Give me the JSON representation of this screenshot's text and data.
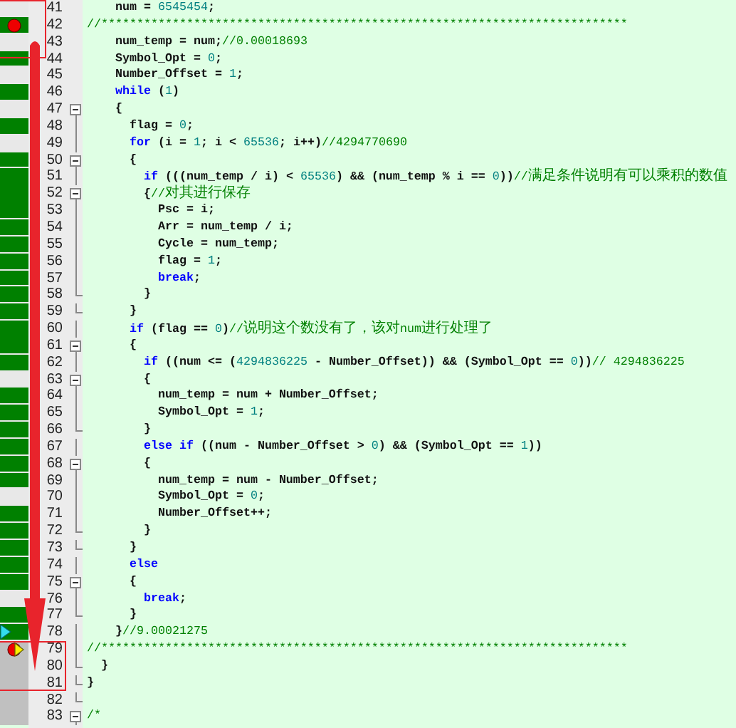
{
  "editor": {
    "lines": [
      {
        "number": "41",
        "breakpoint": false,
        "executed": false,
        "unreached": false,
        "foldable": false,
        "fold_end": false,
        "tokens": [
          {
            "kind": "plain",
            "text": "    num = "
          },
          {
            "kind": "number",
            "text": "6545454"
          },
          {
            "kind": "plain",
            "text": ";"
          }
        ]
      },
      {
        "number": "42",
        "breakpoint": true,
        "executed": true,
        "unreached": false,
        "foldable": false,
        "fold_end": false,
        "tokens": [
          {
            "kind": "comment",
            "text": "//**************************************************************************"
          }
        ]
      },
      {
        "number": "43",
        "breakpoint": false,
        "executed": false,
        "unreached": false,
        "foldable": false,
        "fold_end": false,
        "tokens": [
          {
            "kind": "plain",
            "text": "    num_temp = num;"
          },
          {
            "kind": "comment",
            "text": "//0.00018693"
          }
        ]
      },
      {
        "number": "44",
        "breakpoint": false,
        "executed": true,
        "unreached": false,
        "foldable": false,
        "fold_end": false,
        "tokens": [
          {
            "kind": "plain",
            "text": "    Symbol_Opt = "
          },
          {
            "kind": "number",
            "text": "0"
          },
          {
            "kind": "plain",
            "text": ";"
          }
        ]
      },
      {
        "number": "45",
        "breakpoint": false,
        "executed": false,
        "unreached": false,
        "foldable": false,
        "fold_end": false,
        "tokens": [
          {
            "kind": "plain",
            "text": "    Number_Offset = "
          },
          {
            "kind": "number",
            "text": "1"
          },
          {
            "kind": "plain",
            "text": ";"
          }
        ]
      },
      {
        "number": "46",
        "breakpoint": false,
        "executed": true,
        "unreached": false,
        "foldable": false,
        "fold_end": false,
        "tokens": [
          {
            "kind": "keyword",
            "text": "    while"
          },
          {
            "kind": "plain",
            "text": " ("
          },
          {
            "kind": "number",
            "text": "1"
          },
          {
            "kind": "plain",
            "text": ")"
          }
        ]
      },
      {
        "number": "47",
        "breakpoint": false,
        "executed": false,
        "unreached": false,
        "foldable": true,
        "fold_end": false,
        "tokens": [
          {
            "kind": "plain",
            "text": "    {"
          }
        ]
      },
      {
        "number": "48",
        "breakpoint": false,
        "executed": true,
        "unreached": false,
        "foldable": false,
        "fold_end": false,
        "tokens": [
          {
            "kind": "plain",
            "text": "      flag = "
          },
          {
            "kind": "number",
            "text": "0"
          },
          {
            "kind": "plain",
            "text": ";"
          }
        ]
      },
      {
        "number": "49",
        "breakpoint": false,
        "executed": false,
        "unreached": false,
        "foldable": false,
        "fold_end": false,
        "tokens": [
          {
            "kind": "keyword",
            "text": "      for"
          },
          {
            "kind": "plain",
            "text": " (i = "
          },
          {
            "kind": "number",
            "text": "1"
          },
          {
            "kind": "plain",
            "text": "; i < "
          },
          {
            "kind": "number",
            "text": "65536"
          },
          {
            "kind": "plain",
            "text": "; i++)"
          },
          {
            "kind": "comment",
            "text": "//4294770690"
          }
        ]
      },
      {
        "number": "50",
        "breakpoint": false,
        "executed": true,
        "unreached": false,
        "foldable": true,
        "fold_end": false,
        "tokens": [
          {
            "kind": "plain",
            "text": "      {"
          }
        ]
      },
      {
        "number": "51",
        "breakpoint": false,
        "executed": true,
        "unreached": false,
        "foldable": false,
        "fold_end": false,
        "tokens": [
          {
            "kind": "keyword",
            "text": "        if"
          },
          {
            "kind": "plain",
            "text": " (((num_temp / i) < "
          },
          {
            "kind": "number",
            "text": "65536"
          },
          {
            "kind": "plain",
            "text": ") && (num_temp % i == "
          },
          {
            "kind": "number",
            "text": "0"
          },
          {
            "kind": "plain",
            "text": "))"
          },
          {
            "kind": "comment",
            "text": "//满足条件说明有可以乘积的数值"
          }
        ]
      },
      {
        "number": "52",
        "breakpoint": false,
        "executed": true,
        "unreached": false,
        "foldable": true,
        "fold_end": false,
        "tokens": [
          {
            "kind": "plain",
            "text": "        {"
          },
          {
            "kind": "comment",
            "text": "//对其进行保存"
          }
        ]
      },
      {
        "number": "53",
        "breakpoint": false,
        "executed": true,
        "unreached": false,
        "foldable": false,
        "fold_end": false,
        "tokens": [
          {
            "kind": "plain",
            "text": "          Psc = i;"
          }
        ]
      },
      {
        "number": "54",
        "breakpoint": false,
        "executed": true,
        "unreached": false,
        "foldable": false,
        "fold_end": false,
        "tokens": [
          {
            "kind": "plain",
            "text": "          Arr = num_temp / i;"
          }
        ]
      },
      {
        "number": "55",
        "breakpoint": false,
        "executed": true,
        "unreached": false,
        "foldable": false,
        "fold_end": false,
        "tokens": [
          {
            "kind": "plain",
            "text": "          Cycle = num_temp;"
          }
        ]
      },
      {
        "number": "56",
        "breakpoint": false,
        "executed": true,
        "unreached": false,
        "foldable": false,
        "fold_end": false,
        "tokens": [
          {
            "kind": "plain",
            "text": "          flag = "
          },
          {
            "kind": "number",
            "text": "1"
          },
          {
            "kind": "plain",
            "text": ";"
          }
        ]
      },
      {
        "number": "57",
        "breakpoint": false,
        "executed": true,
        "unreached": false,
        "foldable": false,
        "fold_end": false,
        "tokens": [
          {
            "kind": "keyword",
            "text": "          break"
          },
          {
            "kind": "plain",
            "text": ";"
          }
        ]
      },
      {
        "number": "58",
        "breakpoint": false,
        "executed": true,
        "unreached": false,
        "foldable": false,
        "fold_end": true,
        "tokens": [
          {
            "kind": "plain",
            "text": "        }"
          }
        ]
      },
      {
        "number": "59",
        "breakpoint": false,
        "executed": true,
        "unreached": false,
        "foldable": false,
        "fold_end": true,
        "tokens": [
          {
            "kind": "plain",
            "text": "      }"
          }
        ]
      },
      {
        "number": "60",
        "breakpoint": false,
        "executed": true,
        "unreached": false,
        "foldable": false,
        "fold_end": false,
        "tokens": [
          {
            "kind": "keyword",
            "text": "      if"
          },
          {
            "kind": "plain",
            "text": " (flag == "
          },
          {
            "kind": "number",
            "text": "0"
          },
          {
            "kind": "plain",
            "text": ")"
          },
          {
            "kind": "comment",
            "text": "//说明这个数没有了，该对num进行处理了"
          }
        ]
      },
      {
        "number": "61",
        "breakpoint": false,
        "executed": true,
        "unreached": false,
        "foldable": true,
        "fold_end": false,
        "tokens": [
          {
            "kind": "plain",
            "text": "      {"
          }
        ]
      },
      {
        "number": "62",
        "breakpoint": false,
        "executed": true,
        "unreached": false,
        "foldable": false,
        "fold_end": false,
        "tokens": [
          {
            "kind": "keyword",
            "text": "        if"
          },
          {
            "kind": "plain",
            "text": " ((num <= ("
          },
          {
            "kind": "number",
            "text": "4294836225"
          },
          {
            "kind": "plain",
            "text": " - Number_Offset)) && (Symbol_Opt == "
          },
          {
            "kind": "number",
            "text": "0"
          },
          {
            "kind": "plain",
            "text": "))"
          },
          {
            "kind": "comment",
            "text": "// 4294836225"
          }
        ]
      },
      {
        "number": "63",
        "breakpoint": false,
        "executed": false,
        "unreached": false,
        "foldable": true,
        "fold_end": false,
        "tokens": [
          {
            "kind": "plain",
            "text": "        {"
          }
        ]
      },
      {
        "number": "64",
        "breakpoint": false,
        "executed": true,
        "unreached": false,
        "foldable": false,
        "fold_end": false,
        "tokens": [
          {
            "kind": "plain",
            "text": "          num_temp = num + Number_Offset;"
          }
        ]
      },
      {
        "number": "65",
        "breakpoint": false,
        "executed": true,
        "unreached": false,
        "foldable": false,
        "fold_end": false,
        "tokens": [
          {
            "kind": "plain",
            "text": "          Symbol_Opt = "
          },
          {
            "kind": "number",
            "text": "1"
          },
          {
            "kind": "plain",
            "text": ";"
          }
        ]
      },
      {
        "number": "66",
        "breakpoint": false,
        "executed": true,
        "unreached": false,
        "foldable": false,
        "fold_end": true,
        "tokens": [
          {
            "kind": "plain",
            "text": "        }"
          }
        ]
      },
      {
        "number": "67",
        "breakpoint": false,
        "executed": true,
        "unreached": false,
        "foldable": false,
        "fold_end": false,
        "tokens": [
          {
            "kind": "keyword",
            "text": "        else if"
          },
          {
            "kind": "plain",
            "text": " ((num - Number_Offset > "
          },
          {
            "kind": "number",
            "text": "0"
          },
          {
            "kind": "plain",
            "text": ") && (Symbol_Opt == "
          },
          {
            "kind": "number",
            "text": "1"
          },
          {
            "kind": "plain",
            "text": "))"
          }
        ]
      },
      {
        "number": "68",
        "breakpoint": false,
        "executed": true,
        "unreached": false,
        "foldable": true,
        "fold_end": false,
        "tokens": [
          {
            "kind": "plain",
            "text": "        {"
          }
        ]
      },
      {
        "number": "69",
        "breakpoint": false,
        "executed": true,
        "unreached": false,
        "foldable": false,
        "fold_end": false,
        "tokens": [
          {
            "kind": "plain",
            "text": "          num_temp = num - Number_Offset;"
          }
        ]
      },
      {
        "number": "70",
        "breakpoint": false,
        "executed": false,
        "unreached": false,
        "foldable": false,
        "fold_end": false,
        "tokens": [
          {
            "kind": "plain",
            "text": "          Symbol_Opt = "
          },
          {
            "kind": "number",
            "text": "0"
          },
          {
            "kind": "plain",
            "text": ";"
          }
        ]
      },
      {
        "number": "71",
        "breakpoint": false,
        "executed": true,
        "unreached": false,
        "foldable": false,
        "fold_end": false,
        "tokens": [
          {
            "kind": "plain",
            "text": "          Number_Offset++;"
          }
        ]
      },
      {
        "number": "72",
        "breakpoint": false,
        "executed": true,
        "unreached": false,
        "foldable": false,
        "fold_end": true,
        "tokens": [
          {
            "kind": "plain",
            "text": "        }"
          }
        ]
      },
      {
        "number": "73",
        "breakpoint": false,
        "executed": true,
        "unreached": false,
        "foldable": false,
        "fold_end": true,
        "tokens": [
          {
            "kind": "plain",
            "text": "      }"
          }
        ]
      },
      {
        "number": "74",
        "breakpoint": false,
        "executed": true,
        "unreached": false,
        "foldable": false,
        "fold_end": false,
        "tokens": [
          {
            "kind": "keyword",
            "text": "      else"
          }
        ]
      },
      {
        "number": "75",
        "breakpoint": false,
        "executed": true,
        "unreached": false,
        "foldable": true,
        "fold_end": false,
        "tokens": [
          {
            "kind": "plain",
            "text": "      {"
          }
        ]
      },
      {
        "number": "76",
        "breakpoint": false,
        "executed": false,
        "unreached": false,
        "foldable": false,
        "fold_end": false,
        "tokens": [
          {
            "kind": "keyword",
            "text": "        break"
          },
          {
            "kind": "plain",
            "text": ";"
          }
        ]
      },
      {
        "number": "77",
        "breakpoint": false,
        "executed": true,
        "unreached": false,
        "foldable": false,
        "fold_end": true,
        "tokens": [
          {
            "kind": "plain",
            "text": "      }"
          }
        ]
      },
      {
        "number": "78",
        "breakpoint": false,
        "executed": true,
        "unreached": false,
        "foldable": false,
        "fold_end": false,
        "current": true,
        "caller": false,
        "tokens": [
          {
            "kind": "plain",
            "text": "    }"
          },
          {
            "kind": "comment",
            "text": "//9.00021275"
          }
        ]
      },
      {
        "number": "79",
        "breakpoint": true,
        "executed": false,
        "unreached": true,
        "foldable": false,
        "fold_end": false,
        "current": false,
        "caller": true,
        "tokens": [
          {
            "kind": "comment",
            "text": "//**************************************************************************"
          }
        ]
      },
      {
        "number": "80",
        "breakpoint": false,
        "executed": false,
        "unreached": true,
        "foldable": false,
        "fold_end": true,
        "tokens": [
          {
            "kind": "plain",
            "text": "  }"
          }
        ]
      },
      {
        "number": "81",
        "breakpoint": false,
        "executed": false,
        "unreached": true,
        "foldable": false,
        "fold_end": true,
        "tokens": [
          {
            "kind": "plain",
            "text": "}"
          }
        ]
      },
      {
        "number": "82",
        "breakpoint": false,
        "executed": false,
        "unreached": true,
        "foldable": false,
        "fold_end": true
      },
      {
        "number": "83",
        "breakpoint": false,
        "executed": false,
        "unreached": true,
        "foldable": true,
        "fold_end": false,
        "tokens": [
          {
            "kind": "comment",
            "text": "/*"
          }
        ]
      }
    ]
  }
}
